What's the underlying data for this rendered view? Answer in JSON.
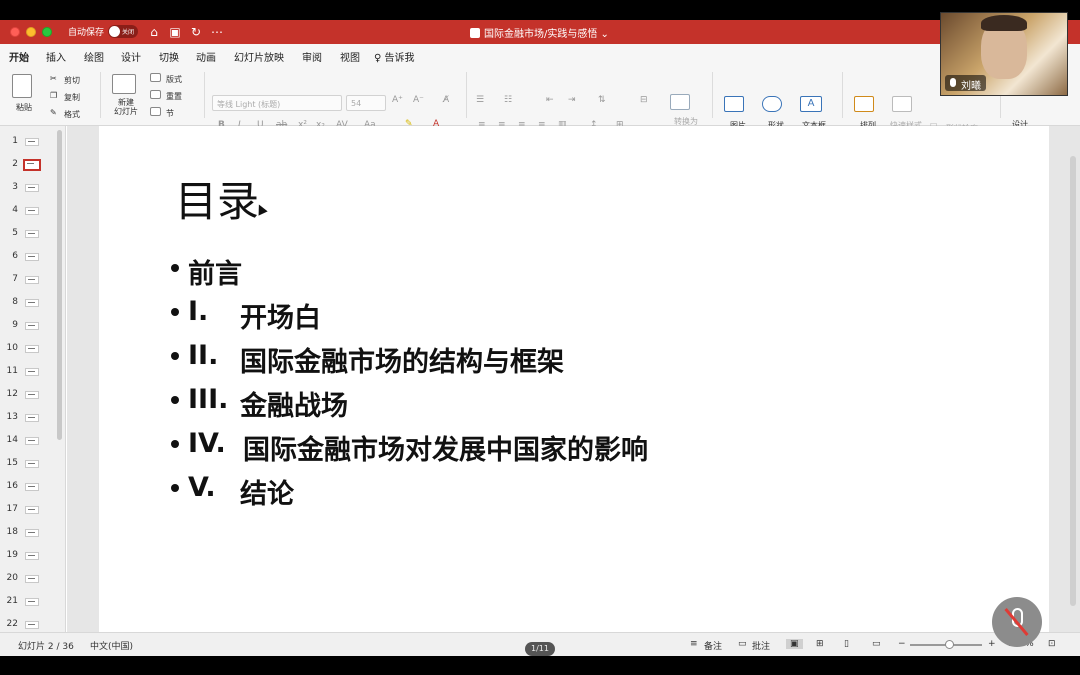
{
  "window": {
    "autosave_label": "自动保存",
    "autosave_state": "关闭",
    "title": "国际金融市场/实践与感悟"
  },
  "ribbon": {
    "tabs": [
      "开始",
      "插入",
      "绘图",
      "设计",
      "切换",
      "动画",
      "幻灯片放映",
      "审阅",
      "视图",
      "告诉我"
    ],
    "active_tab": "开始"
  },
  "toolbar": {
    "paste": "粘贴",
    "cut": "剪切",
    "copy": "复制",
    "format": "格式",
    "new_slide": "新建\n幻灯片",
    "layout": "版式",
    "reset": "重置",
    "section": "节",
    "font_name": "等线 Light (标题)",
    "font_size": "54",
    "convert_smartart": "转换为\nSmartArt",
    "picture": "图片",
    "shapes": "形状",
    "textbox": "文本框",
    "arrange": "排列",
    "quick_styles": "快速样式",
    "shape_outline": "形状轮廓",
    "designer": "设计\n灵感"
  },
  "thumbnails": {
    "numbers": [
      "1",
      "2",
      "3",
      "4",
      "5",
      "6",
      "7",
      "8",
      "9",
      "10",
      "11",
      "12",
      "13",
      "14",
      "15",
      "16",
      "17",
      "18",
      "19",
      "20",
      "21",
      "22"
    ],
    "selected": 2
  },
  "slide": {
    "title": "目录",
    "bullets": [
      {
        "num": "",
        "text": "前言"
      },
      {
        "num": "I.",
        "text": "开场白"
      },
      {
        "num": "II.",
        "text": "国际金融市场的结构与框架"
      },
      {
        "num": "III.",
        "text": "金融战场"
      },
      {
        "num": "IV.",
        "text": "国际金融市场对发展中国家的影响"
      },
      {
        "num": "V.",
        "text": "结论"
      }
    ]
  },
  "statusbar": {
    "slide_position": "幻灯片 2 / 36",
    "language": "中文(中国)",
    "notes": "备注",
    "comments": "批注",
    "zoom": "136%",
    "page_pill": "1/11"
  },
  "video": {
    "participant_name": "刘曦"
  },
  "colors": {
    "accent": "#c4322a",
    "titlebar": "#c4322a"
  }
}
